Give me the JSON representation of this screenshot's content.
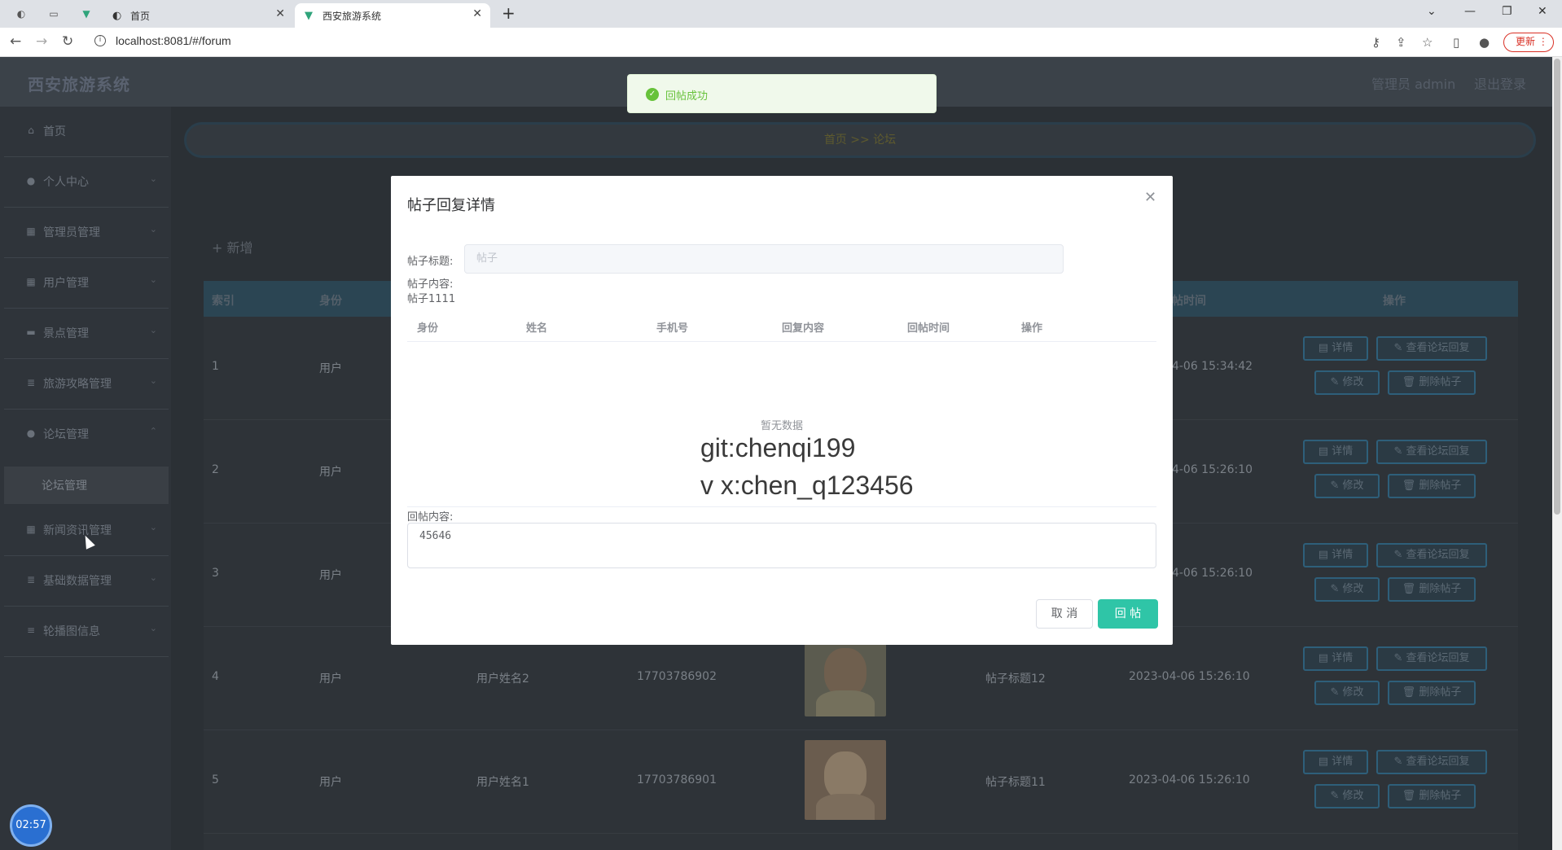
{
  "browser": {
    "tabs": [
      {
        "title": "首页"
      },
      {
        "title": "西安旅游系统"
      }
    ],
    "url": "localhost:8081/#/forum",
    "update_label": "更新"
  },
  "app": {
    "title": "西安旅游系统",
    "admin_label": "管理员 admin",
    "logout_label": "退出登录"
  },
  "sidebar": {
    "items": [
      {
        "label": "首页",
        "icon": "home-icon"
      },
      {
        "label": "个人中心",
        "icon": "user-icon"
      },
      {
        "label": "管理员管理",
        "icon": "grid-icon"
      },
      {
        "label": "用户管理",
        "icon": "grid-icon"
      },
      {
        "label": "景点管理",
        "icon": "chat-icon"
      },
      {
        "label": "旅游攻略管理",
        "icon": "stack-icon"
      },
      {
        "label": "论坛管理",
        "icon": "user-icon"
      },
      {
        "label": "新闻资讯管理",
        "icon": "grid-icon"
      },
      {
        "label": "基础数据管理",
        "icon": "stack-icon"
      },
      {
        "label": "轮播图信息",
        "icon": "menu-icon"
      }
    ],
    "submenu_forum": "论坛管理",
    "timer": "02:57"
  },
  "main": {
    "breadcrumb": "首页  >>  论坛",
    "add_label": "+ 新增",
    "table_headers": {
      "index": "索引",
      "identity": "身份",
      "post_time": "发帖时间",
      "actions": "操作"
    },
    "rows": [
      {
        "index": "1",
        "identity": "用户",
        "name": "",
        "phone": "",
        "title": "",
        "time": "-04-06 15:34:42"
      },
      {
        "index": "2",
        "identity": "用户",
        "name": "",
        "phone": "",
        "title": "",
        "time": "-04-06 15:26:10"
      },
      {
        "index": "3",
        "identity": "用户",
        "name": "",
        "phone": "",
        "title": "",
        "time": "-04-06 15:26:10"
      },
      {
        "index": "4",
        "identity": "用户",
        "name": "用户姓名2",
        "phone": "17703786902",
        "title": "帖子标题12",
        "time": "2023-04-06 15:26:10"
      },
      {
        "index": "5",
        "identity": "用户",
        "name": "用户姓名1",
        "phone": "17703786901",
        "title": "帖子标题11",
        "time": "2023-04-06 15:26:10"
      }
    ],
    "op_labels": {
      "detail": "详情",
      "view_replies": "查看论坛回复",
      "edit": "修改",
      "delete": "删除帖子"
    }
  },
  "toast": {
    "text": "回帖成功",
    "color": "#67c23a"
  },
  "dialog": {
    "title": "帖子回复详情",
    "post_title_label": "帖子标题:",
    "post_title_value": "帖子",
    "post_content_label": "帖子内容:",
    "post_content_value": "帖子1111",
    "columns": [
      "身份",
      "姓名",
      "手机号",
      "回复内容",
      "回帖时间",
      "操作"
    ],
    "empty_text": "暂无数据",
    "watermark_line1": "git:chenqi199",
    "watermark_line2": "v x:chen_q123456",
    "reply_label": "回帖内容:",
    "reply_value": "45646",
    "cancel_label": "取 消",
    "submit_label": "回 帖",
    "accent_color": "#2fc5a7"
  }
}
